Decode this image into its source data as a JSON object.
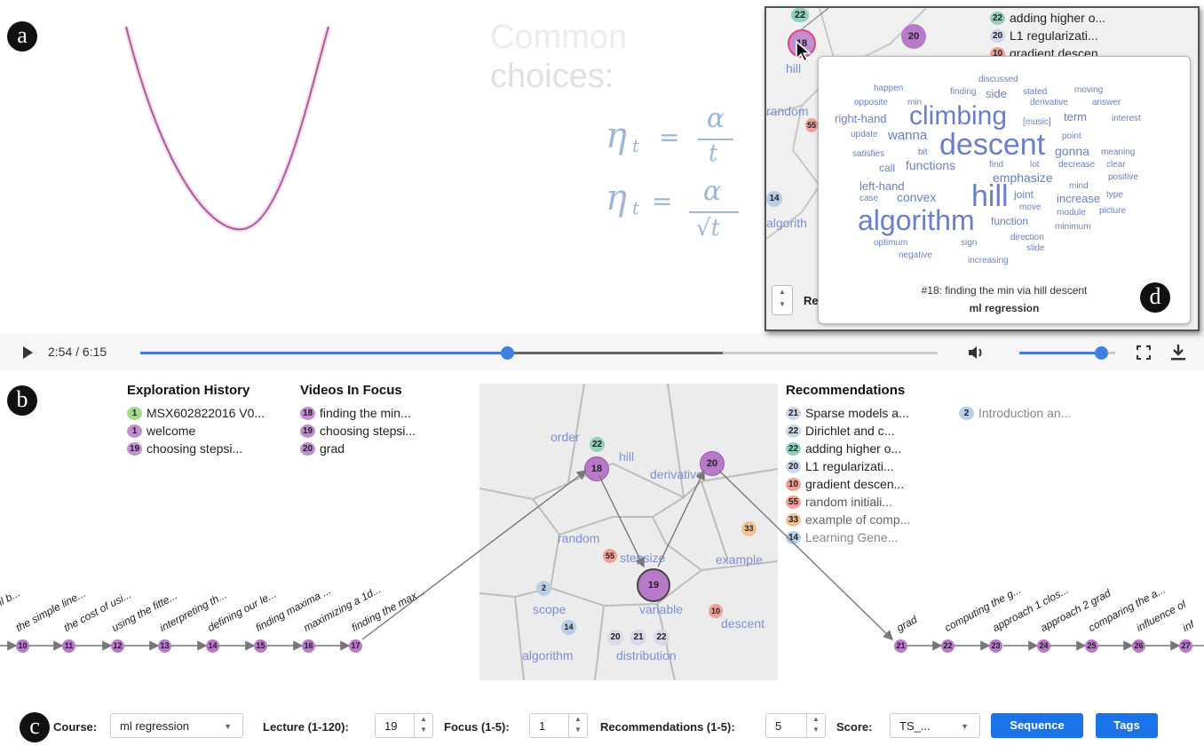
{
  "video": {
    "slide_title_line1": "Common",
    "slide_title_line2": "choices:",
    "eta1_num": "α",
    "eta1_den": "t",
    "eta2_num": "α",
    "eta2_den": "√t",
    "eta_sym": "η",
    "eta_sub": "t",
    "eq": "="
  },
  "controls": {
    "time": "2:54 / 6:15",
    "progress": 0.46,
    "buffered": 0.73,
    "volume": 0.85
  },
  "panel_letters": {
    "a": "a",
    "b": "b",
    "c": "c",
    "d": "d"
  },
  "history": {
    "title": "Exploration History",
    "items": [
      {
        "num": "1",
        "label": "MSX602822016 V0...",
        "color": "green"
      },
      {
        "num": "1",
        "label": "welcome",
        "color": "purple"
      },
      {
        "num": "19",
        "label": "choosing stepsi...",
        "color": "purple"
      }
    ]
  },
  "focus": {
    "title": "Videos In Focus",
    "items": [
      {
        "num": "18",
        "label": "finding the min..."
      },
      {
        "num": "19",
        "label": "choosing stepsi..."
      },
      {
        "num": "20",
        "label": "grad"
      }
    ]
  },
  "recommendations": {
    "title": "Recommendations",
    "items": [
      {
        "num": "21",
        "label": "Sparse models a...",
        "color": "grey"
      },
      {
        "num": "22",
        "label": "Dirichlet and c...",
        "color": "grey"
      },
      {
        "num": "22",
        "label": "adding higher o...",
        "color": "teal"
      },
      {
        "num": "20",
        "label": "L1 regularizati...",
        "color": "grey"
      },
      {
        "num": "10",
        "label": "gradient descen...",
        "color": "red"
      },
      {
        "num": "55",
        "label": "random initiali...",
        "color": "red"
      },
      {
        "num": "33",
        "label": "example of comp...",
        "color": "orange"
      },
      {
        "num": "14",
        "label": "Learning Gene...",
        "color": "blue"
      }
    ],
    "extra": {
      "num": "2",
      "label": "Introduction an..."
    }
  },
  "map": {
    "labels": [
      "order",
      "hill",
      "derivative",
      "random",
      "stepsize",
      "example",
      "scope",
      "variable",
      "descent",
      "algorithm",
      "distribution"
    ],
    "nodes": {
      "n22": "22",
      "n18": "18",
      "n20": "20",
      "n33": "33",
      "n55": "55",
      "n19": "19",
      "n2": "2",
      "n10": "10",
      "n14": "14",
      "n20b": "20",
      "n21": "21",
      "n22b": "22"
    }
  },
  "left_sequence": {
    "nums": [
      "10",
      "11",
      "12",
      "13",
      "14",
      "15",
      "16",
      "17"
    ],
    "labels": [
      "...ion ml b...",
      "the simple line...",
      "the cost of usi...",
      "using the fitte...",
      "interpreting th...",
      "defining our le...",
      "finding maxima ...",
      "maximizing a 1d...",
      "finding the max..."
    ]
  },
  "right_sequence": {
    "nums": [
      "21",
      "22",
      "23",
      "24",
      "25",
      "26",
      "27"
    ],
    "labels": [
      "grad",
      "computing the g...",
      "approach 1 clos...",
      "approach 2 grad",
      "comparing the a...",
      "influence of",
      "inf"
    ]
  },
  "toolbar": {
    "course_label": "Course:",
    "course_value": "ml regression",
    "lecture_label": "Lecture (1-120):",
    "lecture_value": "19",
    "focus_label": "Focus (1-5):",
    "focus_value": "1",
    "rec_label": "Recommendations (1-5):",
    "rec_value": "5",
    "score_label": "Score:",
    "score_value": "TS_...",
    "sequence_btn": "Sequence",
    "tags_btn": "Tags"
  },
  "inset": {
    "list": [
      {
        "num": "22",
        "label": "adding higher o..."
      },
      {
        "num": "20",
        "label": "L1 regularizati..."
      },
      {
        "num": "10",
        "label": "gradient descen..."
      }
    ],
    "node18": "18",
    "node20": "20",
    "node22": "22",
    "node14": "14",
    "node55": "55",
    "bg_labels": [
      "hill",
      "random",
      "algorith",
      "Re"
    ],
    "caption": "#18: finding the min via hill descent",
    "course": "ml regression",
    "words": {
      "w1": "discussed",
      "w2": "happen",
      "w3": "finding",
      "w4": "side",
      "w5": "stated",
      "w6": "moving",
      "w7": "opposite",
      "w8": "min",
      "w9": "derivative",
      "w10": "answer",
      "w11": "right-hand",
      "w12": "climbing",
      "w13": "[music]",
      "w14": "term",
      "w15": "interest",
      "w16": "update",
      "w17": "wanna",
      "w18": "descent",
      "w19": "point",
      "w20": "satisfies",
      "w21": "bit",
      "w22": "gonna",
      "w23": "meaning",
      "w24": "call",
      "w25": "functions",
      "w26": "find",
      "w27": "lot",
      "w28": "decrease",
      "w29": "clear",
      "w30": "emphasize",
      "w31": "positive",
      "w32": "left-hand",
      "w33": "mind",
      "w34": "case",
      "w35": "convex",
      "w36": "hill",
      "w37": "joint",
      "w38": "increase",
      "w39": "type",
      "w40": "move",
      "w41": "module",
      "w42": "picture",
      "w43": "algorithm",
      "w44": "function",
      "w45": "minimum",
      "w46": "optimum",
      "w47": "sign",
      "w48": "direction",
      "w49": "negative",
      "w50": "slide",
      "w51": "increasing"
    }
  }
}
